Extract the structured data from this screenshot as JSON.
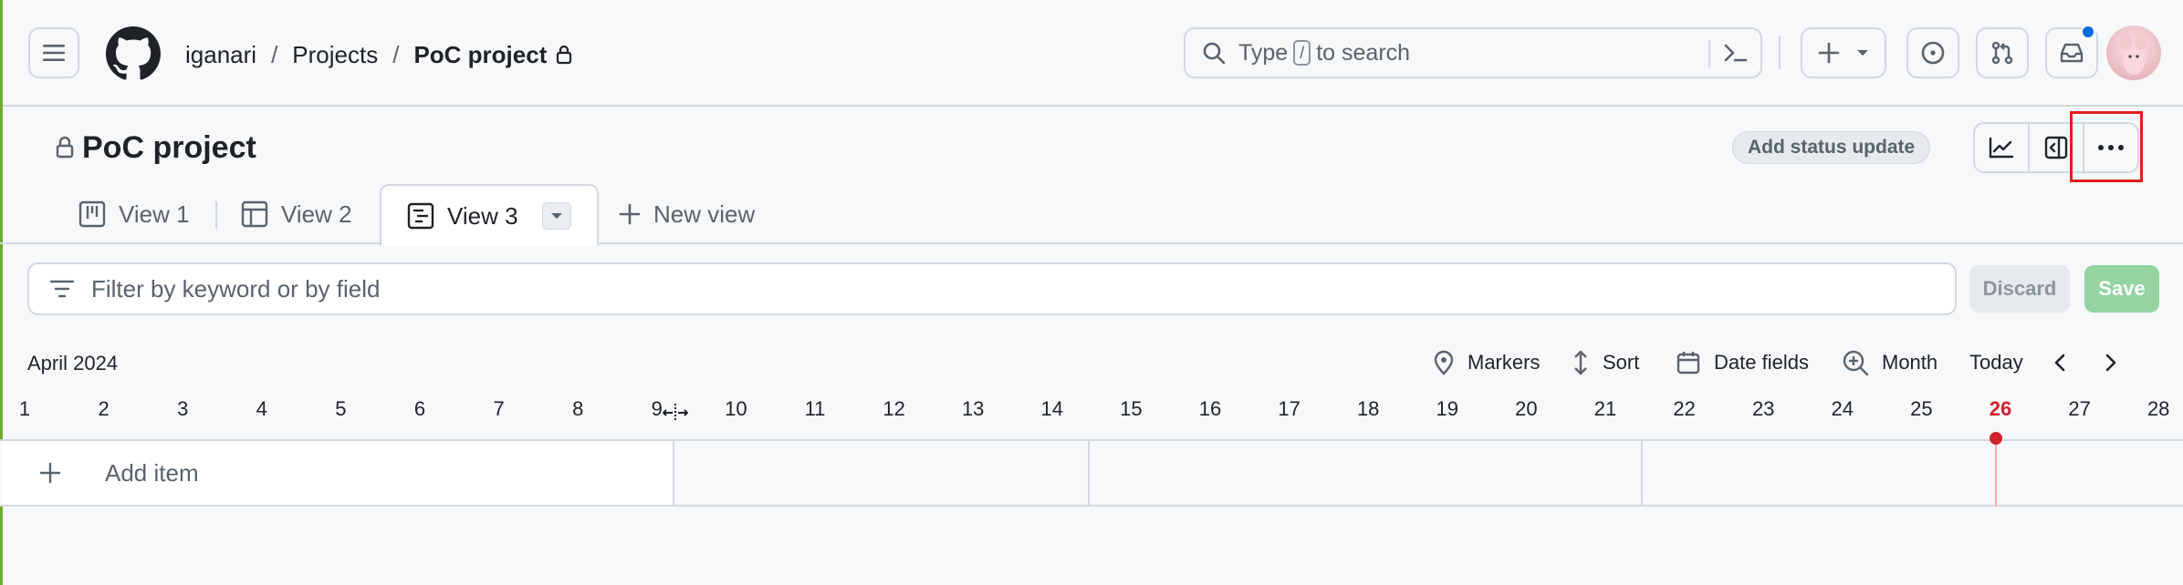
{
  "header": {
    "breadcrumb": {
      "owner": "iganari",
      "section": "Projects",
      "project": "PoC project",
      "separator": "/"
    },
    "search": {
      "prefix": "Type",
      "key": "/",
      "suffix": "to search"
    }
  },
  "project": {
    "title": "PoC project",
    "status_button": "Add status update"
  },
  "tabs": [
    {
      "label": "View 1",
      "icon": "board-icon",
      "active": false
    },
    {
      "label": "View 2",
      "icon": "table-icon",
      "active": false
    },
    {
      "label": "View 3",
      "icon": "roadmap-icon",
      "active": true
    }
  ],
  "new_view_label": "New view",
  "filter": {
    "placeholder": "Filter by keyword or by field",
    "discard_label": "Discard",
    "save_label": "Save"
  },
  "roadmap": {
    "month": "April 2024",
    "toolbar": {
      "markers": "Markers",
      "sort": "Sort",
      "date_fields": "Date fields",
      "zoom": "Month",
      "today": "Today"
    },
    "days": [
      "1",
      "2",
      "3",
      "4",
      "5",
      "6",
      "7",
      "8",
      "9",
      "10",
      "11",
      "12",
      "13",
      "14",
      "15",
      "16",
      "17",
      "18",
      "19",
      "20",
      "21",
      "22",
      "23",
      "24",
      "25",
      "26",
      "27",
      "28"
    ],
    "today_day": "26",
    "add_item_label": "Add item"
  },
  "colors": {
    "accent_blue": "#0969da",
    "today_red": "#cf222e",
    "save_green": "#94d3a2",
    "highlight_red": "#e0201b"
  }
}
